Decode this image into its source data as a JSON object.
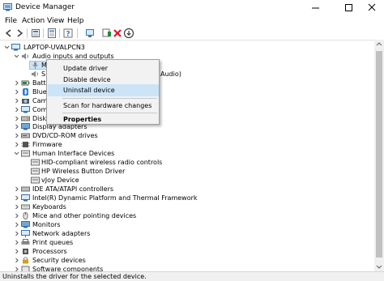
{
  "window": {
    "title": "Device Manager",
    "minimize_glyph": "—",
    "maximize_glyph": "☐",
    "close_glyph": "✕"
  },
  "menu": [
    "File",
    "Action",
    "View",
    "Help"
  ],
  "toolbar": {
    "buttons": [
      "back-icon",
      "forward-icon",
      "computer-view-icon",
      "properties-icon",
      "help-icon",
      "update-driver-icon",
      "monitor-icon",
      "add-driver-icon",
      "uninstall-icon",
      "download-icon"
    ]
  },
  "tree": {
    "root": "LAPTOP-UVALPCN3",
    "audio_group": "Audio inputs and outputs",
    "audio_child_1_partial": "M",
    "audio_child_2_partial": "S",
    "audio_child_2_suffix": "Audio)",
    "partial_rows": [
      "Batte",
      "Bluet",
      "Cam",
      "Com",
      "Disk"
    ],
    "categories_after_menu": [
      "Display adapters",
      "DVD/CD-ROM drives",
      "Firmware"
    ],
    "hid_group": "Human Interface Devices",
    "hid_children": [
      "HID-compliant wireless radio controls",
      "HP Wireless Button Driver",
      "vJoy Device"
    ],
    "categories_after_hid": [
      "IDE ATA/ATAPI controllers",
      "Intel(R) Dynamic Platform and Thermal Framework",
      "Keyboards",
      "Mice and other pointing devices",
      "Monitors",
      "Network adapters",
      "Print queues",
      "Processors",
      "Security devices",
      "Software components"
    ]
  },
  "context_menu": {
    "items": [
      "Update driver",
      "Disable device",
      "Uninstall device",
      "Scan for hardware changes",
      "Properties"
    ],
    "highlighted_index": 2
  },
  "status": "Uninstalls the driver for the selected device.",
  "colors": {
    "highlight": "#cce4f7",
    "menu_bg": "#f2f2f2",
    "accent_blue": "#2b7cd3",
    "uninstall_red": "#e81123",
    "add_green": "#1e8c3a"
  }
}
